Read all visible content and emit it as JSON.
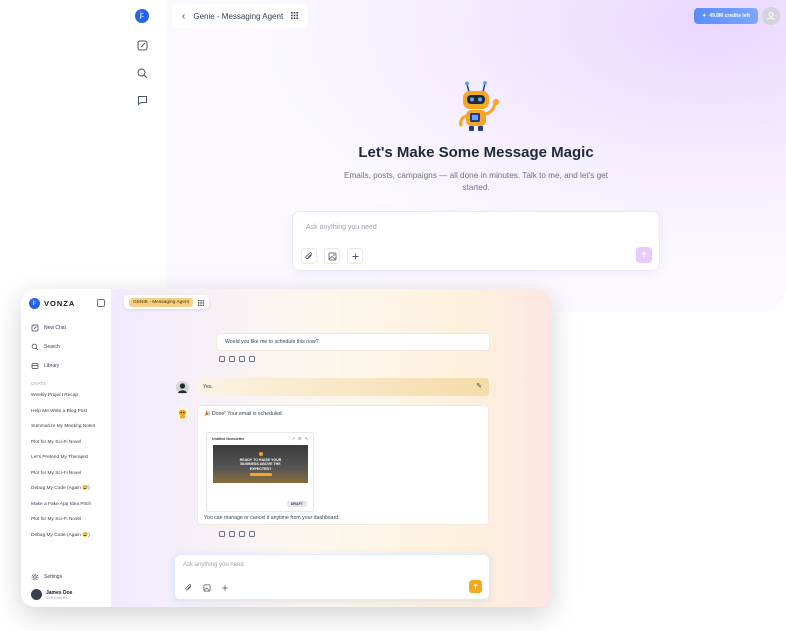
{
  "back_window": {
    "header_title": "Genie - Messaging Agent",
    "credits": "49.8M credits left",
    "logo_text": "j:",
    "hero_title": "Let's Make Some Message Magic",
    "hero_subtitle": "Emails, posts, campaigns — all done in minutes. Talk to me, and let's get started.",
    "input_placeholder": "Ask anything you need"
  },
  "front_window": {
    "brand": "VONZA",
    "logo_text": "j:",
    "nav": [
      {
        "label": "New Chat",
        "icon": "compose-icon"
      },
      {
        "label": "Search",
        "icon": "search-icon"
      },
      {
        "label": "Library",
        "icon": "library-icon"
      }
    ],
    "chats_label": "CHATS",
    "chats": [
      "Weekly Project Recap",
      "Help Me Write a Blog Post",
      "Summarize My Meeting Notes",
      "Plot for My Sci-Fi Novel",
      "Let's Pretend My Therapist",
      "Plot for My Sci-Fi Novel",
      "Debug My Code (Again 😅)",
      "Make a Fake App Idea Pitch",
      "Plot for My Sci-Fi Novel",
      "Debug My Code (Again 😅)"
    ],
    "settings_label": "Settings",
    "user_name": "James Doe",
    "user_sub": "CVE Draft left",
    "header_tag": "GENIE - Messaging Agent",
    "messages": {
      "agent_1": "Would you like me to schedule this now?",
      "user_1": "Yes.",
      "agent_2": "🎉 Done! Your email is scheduled.",
      "newsletter_title": "Untitled Newsletter",
      "newsletter_headline": "READY TO RAISE YOUR BUSINESS ABOVE THE EXPECTED?",
      "newsletter_badge": "DRAFT",
      "agent_3": "You can manage or cancel it anytime from your dashboard."
    },
    "input_placeholder": "Ask anything you need"
  },
  "colors": {
    "brand_blue": "#2563eb",
    "accent_orange": "#f5a623",
    "purple_send": "#e9c9ff"
  }
}
